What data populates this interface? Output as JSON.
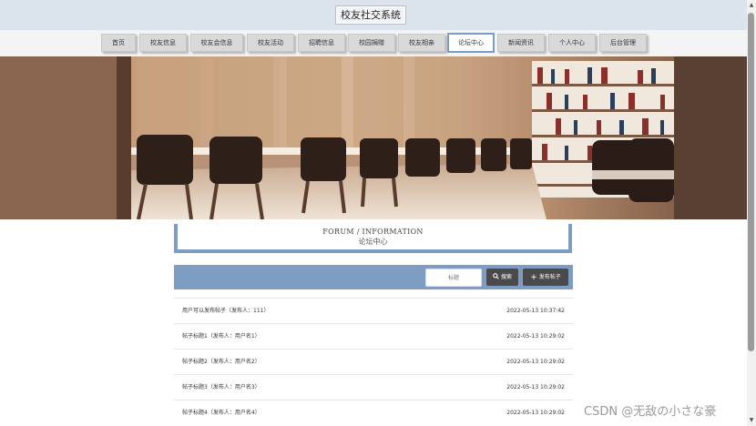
{
  "header": {
    "title": "校友社交系统"
  },
  "nav": {
    "items": [
      {
        "label": "首页",
        "active": false
      },
      {
        "label": "校友信息",
        "active": false
      },
      {
        "label": "校友会信息",
        "active": false
      },
      {
        "label": "校友活动",
        "active": false
      },
      {
        "label": "招聘信息",
        "active": false
      },
      {
        "label": "校园捐赠",
        "active": false
      },
      {
        "label": "校友相亲",
        "active": false
      },
      {
        "label": "论坛中心",
        "active": true
      },
      {
        "label": "新闻资讯",
        "active": false
      },
      {
        "label": "个人中心",
        "active": false
      },
      {
        "label": "后台管理",
        "active": false
      }
    ]
  },
  "carousel": {
    "slide_count": 3,
    "active_index": 0
  },
  "forum": {
    "title_en": "FORUM / INFORMATION",
    "title_cn": "论坛中心"
  },
  "search": {
    "placeholder": "标题",
    "button_label": "搜索",
    "post_button_label": "发布帖子"
  },
  "posts": [
    {
      "title": "用户可以发布帖子（发布人：111）",
      "time": "2022-05-13 10:37:42"
    },
    {
      "title": "帖子标题1（发布人：用户名1）",
      "time": "2022-05-13 10:29:02"
    },
    {
      "title": "帖子标题2（发布人：用户名2）",
      "time": "2022-05-13 10:29:02"
    },
    {
      "title": "帖子标题3（发布人：用户名3）",
      "time": "2022-05-13 10:29:02"
    },
    {
      "title": "帖子标题4（发布人：用户名4）",
      "time": "2022-05-13 10:29:02"
    }
  ],
  "watermark": "CSDN @无敌の小さな豪",
  "colors": {
    "accent": "#7f9cc3",
    "header_bg": "#dbe3ec",
    "button_dark": "#4a4a4a"
  }
}
